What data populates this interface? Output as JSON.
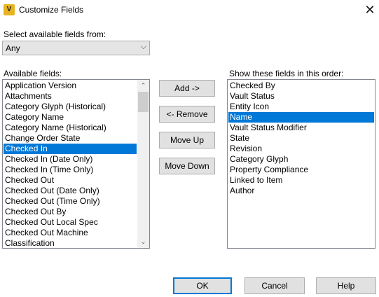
{
  "window": {
    "title": "Customize Fields",
    "app_icon_letter": "V",
    "close_glyph": "✕"
  },
  "source": {
    "label": "Select available fields from:",
    "selected": "Any",
    "arrow_glyph": "⌵"
  },
  "available": {
    "label": "Available fields:",
    "items": [
      "Application Version",
      "Attachments",
      "Category Glyph (Historical)",
      "Category Name",
      "Category Name (Historical)",
      "Change Order State",
      "Checked In",
      "Checked In (Date Only)",
      "Checked In (Time Only)",
      "Checked Out",
      "Checked Out (Date Only)",
      "Checked Out (Time Only)",
      "Checked Out By",
      "Checked Out Local Spec",
      "Checked Out Machine",
      "Classification"
    ],
    "selected_index": 6,
    "scroll_up_glyph": "⌃",
    "scroll_down_glyph": "⌄"
  },
  "actions": {
    "add": "Add ->",
    "remove": "<- Remove",
    "move_up": "Move Up",
    "move_down": "Move Down"
  },
  "shown": {
    "label": "Show these fields in this order:",
    "items": [
      "Checked By",
      "Vault Status",
      "Entity Icon",
      "Name",
      "Vault Status Modifier",
      "State",
      "Revision",
      "Category Glyph",
      "Property Compliance",
      "Linked to Item",
      "Author"
    ],
    "selected_index": 3
  },
  "footer": {
    "ok": "OK",
    "cancel": "Cancel",
    "help": "Help"
  },
  "colors": {
    "selection": "#0078d7",
    "app_icon": "#e8b323"
  }
}
